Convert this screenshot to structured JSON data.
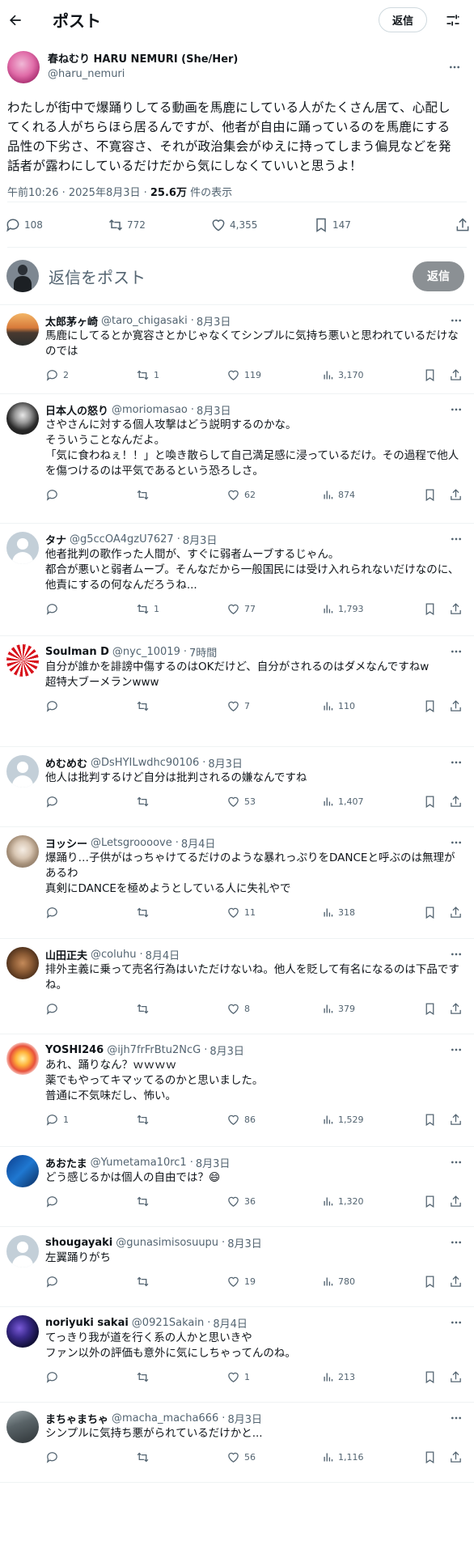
{
  "header": {
    "title": "ポスト",
    "reply_pill": "返信"
  },
  "post": {
    "author_name": "春ねむり HARU NEMURI (She/Her)",
    "author_handle": "@haru_nemuri",
    "text": "わたしが街中で爆踊りしてる動画を馬鹿にしている人がたくさん居て、心配してくれる人がちらほら居るんですが、他者が自由に踊っているのを馬鹿にする品性の下劣さ、不寛容さ、それが政治集会がゆえに持ってしまう偏見などを発話者が露わにしているだけだから気にしなくていいと思うよ！",
    "time": "午前10:26 · 2025年8月3日 · ",
    "views": "25.6万",
    "views_label": " 件の表示",
    "replies": "108",
    "reposts": "772",
    "likes": "4,355",
    "bookmarks": "147"
  },
  "reply_box": {
    "placeholder": "返信をポスト",
    "button": "返信"
  },
  "replies": [
    {
      "name": "太郎茅ヶ崎",
      "handle": "@taro_chigasaki",
      "time": "8月3日",
      "text": "馬鹿にしてるとか寛容さとかじゃなくてシンプルに気持ち悪いと思われているだけなのでは",
      "replies": "2",
      "reposts": "1",
      "likes": "119",
      "views": "3,170",
      "avatar": "sunset",
      "height": 110
    },
    {
      "name": "日本人の怒り",
      "handle": "@moriomasao",
      "time": "8月3日",
      "text": "さやさんに対する個人攻撃はどう説明するのかな。\nそういうことなんだよ。\n「気に食わねぇ！！」と喚き散らして自己満足感に浸っているだけ。その過程で他人を傷つけるのは平気であるという恐ろしさ。",
      "replies": "",
      "reposts": "",
      "likes": "62",
      "views": "874",
      "avatar": "bw",
      "height": 160
    },
    {
      "name": "タナ",
      "handle": "@g5ccOA4gzU7627",
      "time": "8月3日",
      "text": "他者批判の歌作った人間が、すぐに弱者ムーブするじゃん。\n都合が悪いと弱者ムーブ。そんなだから一般国民には受け入れられないだけなのに、他責にするの何なんだろうね...",
      "replies": "",
      "reposts": "1",
      "likes": "77",
      "views": "1,793",
      "avatar": "default",
      "height": 139
    },
    {
      "name": "Soulman D",
      "handle": "@nyc_10019",
      "time": "7時間",
      "text": "自分が誰かを誹謗中傷するのはOKだけど、自分がされるのはダメなんですねw\n超特大ブーメランwww",
      "replies": "",
      "reposts": "",
      "likes": "7",
      "views": "110",
      "avatar": "rising",
      "height": 137
    },
    {
      "name": "めむめむ",
      "handle": "@DsHYILwdhc90106",
      "time": "8月3日",
      "text": "他人は批判するけど自分は批判されるの嫌なんですね",
      "replies": "",
      "reposts": "",
      "likes": "53",
      "views": "1,407",
      "avatar": "default",
      "height": 99
    },
    {
      "name": "ヨッシー",
      "handle": "@Letsgroooove",
      "time": "8月4日",
      "text": "爆踊り…子供がはっちゃけてるだけのような暴れっぷりをDANCEと呼ぶのは無理があるわ\n真剣にDANCEを極めようとしている人に失礼やで",
      "replies": "",
      "reposts": "",
      "likes": "11",
      "views": "318",
      "avatar": "dog",
      "height": 138
    },
    {
      "name": "山田正夫",
      "handle": "@coluhu",
      "time": "8月4日",
      "text": "排外主義に乗って売名行為はいただけないね。他人を貶して有名になるのは下品ですね。",
      "replies": "",
      "reposts": "",
      "likes": "8",
      "views": "379",
      "avatar": "animal",
      "height": 118
    },
    {
      "name": "YOSHI246",
      "handle": "@ijh7frFrBtu2NcG",
      "time": "8月3日",
      "text": "あれ、踊りなん？ｗｗｗｗ\n薬でもやってキマッてるのかと思いました。\n普通に不気味だし、怖い。",
      "replies": "1",
      "reposts": "",
      "likes": "86",
      "views": "1,529",
      "avatar": "flower",
      "height": 139
    },
    {
      "name": "あおたま",
      "handle": "@Yumetama10rc1",
      "time": "8月3日",
      "text": "どう感じるかは個人の自由では？😄",
      "replies": "",
      "reposts": "",
      "likes": "36",
      "views": "1,320",
      "avatar": "blue",
      "height": 99
    },
    {
      "name": "shougayaki",
      "handle": "@gunasimisosuupu",
      "time": "8月3日",
      "text": "左翼踊りがち",
      "replies": "",
      "reposts": "",
      "likes": "19",
      "views": "780",
      "avatar": "default",
      "height": 99
    },
    {
      "name": "noriyuki sakai",
      "handle": "@0921Sakain",
      "time": "8月4日",
      "text": "てっきり我が道を行く系の人かと思いきや\nファン以外の評価も意外に気にしちゃってんのね。",
      "replies": "",
      "reposts": "",
      "likes": "1",
      "views": "213",
      "avatar": "space",
      "height": 118
    },
    {
      "name": "まちゃまちゃ",
      "handle": "@macha_macha666",
      "time": "8月3日",
      "text": "シンプルに気持ち悪がられているだけかと...",
      "replies": "",
      "reposts": "",
      "likes": "56",
      "views": "1,116",
      "avatar": "photo",
      "height": 99
    }
  ]
}
